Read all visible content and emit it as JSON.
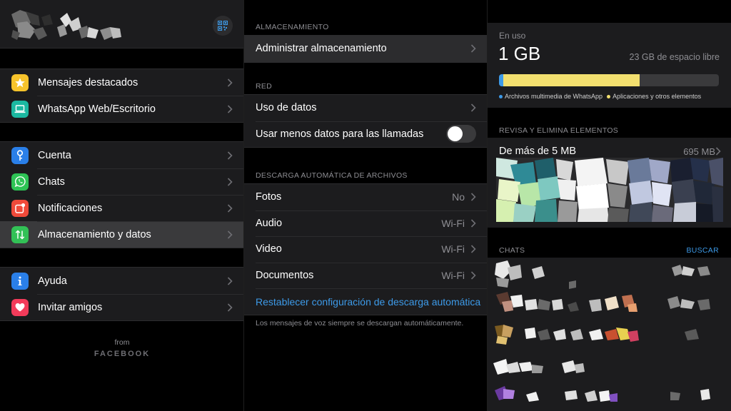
{
  "left_panel": {
    "menu_groups": [
      [
        {
          "label": "Mensajes destacados",
          "icon": "star-icon",
          "color": "#f7c32b"
        },
        {
          "label": "WhatsApp Web/Escritorio",
          "icon": "laptop-icon",
          "color": "#1bb8a1"
        }
      ],
      [
        {
          "label": "Cuenta",
          "icon": "key-icon",
          "color": "#2a7fe8"
        },
        {
          "label": "Chats",
          "icon": "whatsapp-icon",
          "color": "#2ec355"
        },
        {
          "label": "Notificaciones",
          "icon": "notification-icon",
          "color": "#f04a3a"
        },
        {
          "label": "Almacenamiento y datos",
          "icon": "data-arrows-icon",
          "color": "#32c156",
          "selected": true
        }
      ],
      [
        {
          "label": "Ayuda",
          "icon": "info-icon",
          "color": "#2a7fe8"
        },
        {
          "label": "Invitar amigos",
          "icon": "heart-icon",
          "color": "#f23b5a"
        }
      ]
    ],
    "from_label": "from",
    "brand_label": "FACEBOOK"
  },
  "middle_panel": {
    "storage_section": {
      "title": "ALMACENAMIENTO",
      "items": [
        {
          "label": "Administrar almacenamiento"
        }
      ]
    },
    "network_section": {
      "title": "RED",
      "items": [
        {
          "label": "Uso de datos"
        },
        {
          "label": "Usar menos datos para las llamadas",
          "toggle": false
        }
      ]
    },
    "autodownload_section": {
      "title": "DESCARGA AUTOMÁTICA DE ARCHIVOS",
      "items": [
        {
          "label": "Fotos",
          "value": "No"
        },
        {
          "label": "Audio",
          "value": "Wi-Fi"
        },
        {
          "label": "Video",
          "value": "Wi-Fi"
        },
        {
          "label": "Documentos",
          "value": "Wi-Fi"
        }
      ],
      "reset_link": "Restablecer configuración de descarga automática",
      "footnote": "Los mensajes de voz siempre se descargan automáticamente."
    }
  },
  "right_panel": {
    "usage": {
      "label": "En uso",
      "value": "1 GB",
      "free": "23 GB de espacio libre",
      "whatsapp_fraction": 0.02,
      "apps_fraction": 0.62,
      "legend_whatsapp": "Archivos multimedia de WhatsApp",
      "legend_apps": "Aplicaciones y otros elementos",
      "color_whatsapp": "#3d9ae8",
      "color_apps": "#f2df6f"
    },
    "review": {
      "title": "REVISA Y ELIMINA ELEMENTOS",
      "item_label": "De más de 5 MB",
      "item_size": "695 MB"
    },
    "chats": {
      "title": "CHATS",
      "search_label": "BUSCAR"
    }
  }
}
